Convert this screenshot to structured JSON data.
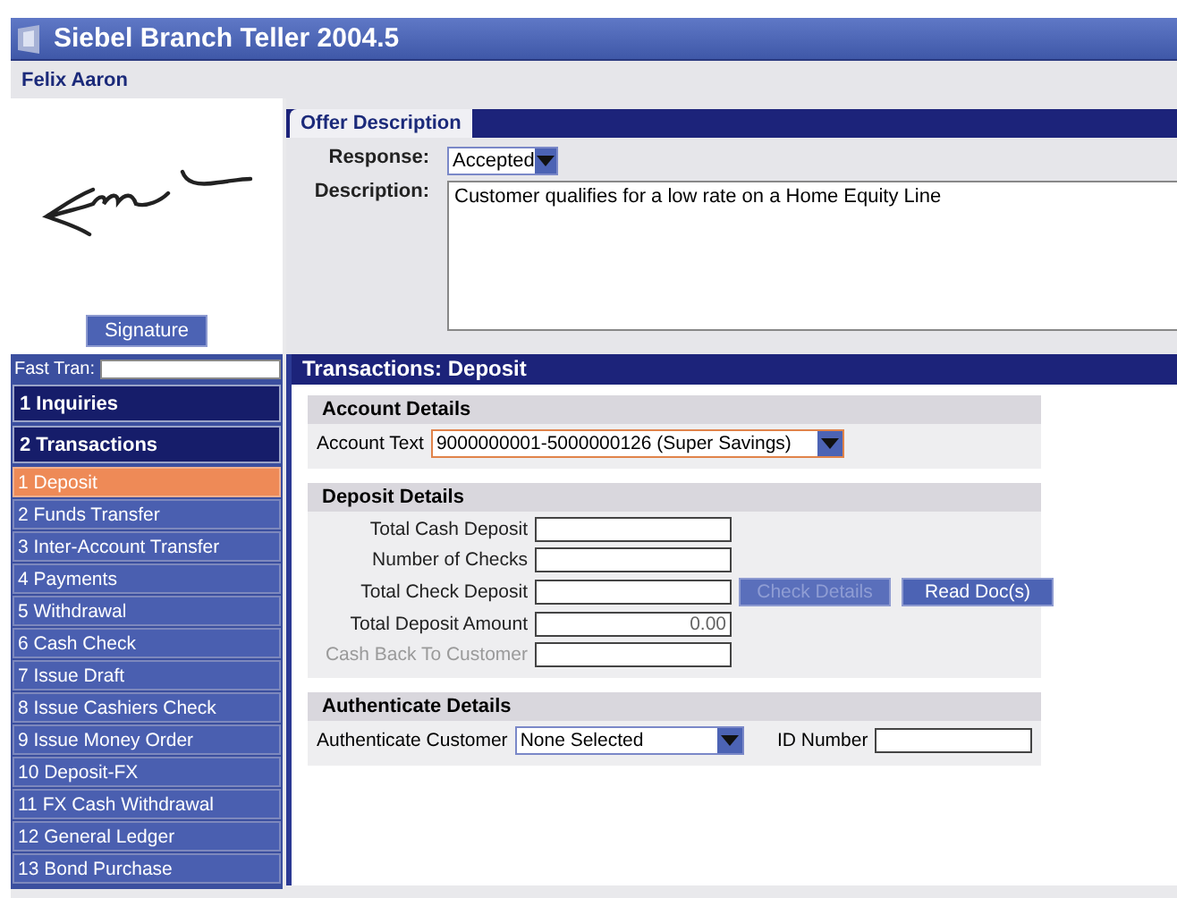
{
  "window": {
    "title": "Siebel Branch Teller 2004.5"
  },
  "customer_name": "Felix Aaron",
  "signature": {
    "button": "Signature"
  },
  "offer": {
    "tabs": [
      {
        "label": "Offer Description",
        "selected": true
      }
    ],
    "response": {
      "label": "Response:",
      "value": "Accepted"
    },
    "description": {
      "label": "Description:",
      "value": "Customer qualifies for a low rate on a Home Equity Line"
    }
  },
  "fast_tran": {
    "label": "Fast Tran:"
  },
  "nav": [
    {
      "label": "1 Inquiries",
      "kind": "group",
      "selected": false
    },
    {
      "label": "2 Transactions",
      "kind": "group",
      "selected": false
    },
    {
      "label": "1 Deposit",
      "kind": "item",
      "selected": true
    },
    {
      "label": "2 Funds Transfer",
      "kind": "item",
      "selected": false
    },
    {
      "label": "3 Inter-Account Transfer",
      "kind": "item",
      "selected": false
    },
    {
      "label": "4 Payments",
      "kind": "item",
      "selected": false
    },
    {
      "label": "5 Withdrawal",
      "kind": "item",
      "selected": false
    },
    {
      "label": "6 Cash Check",
      "kind": "item",
      "selected": false
    },
    {
      "label": "7 Issue Draft",
      "kind": "item",
      "selected": false
    },
    {
      "label": "8 Issue Cashiers Check",
      "kind": "item",
      "selected": false
    },
    {
      "label": "9 Issue Money Order",
      "kind": "item",
      "selected": false
    },
    {
      "label": "10 Deposit-FX",
      "kind": "item",
      "selected": false
    },
    {
      "label": "11 FX Cash Withdrawal",
      "kind": "item",
      "selected": false
    },
    {
      "label": "12 General Ledger",
      "kind": "item",
      "selected": false
    },
    {
      "label": "13 Bond Purchase",
      "kind": "item",
      "selected": false
    }
  ],
  "transaction": {
    "title": "Transactions: Deposit",
    "account_details": {
      "title": "Account Details",
      "label": "Account Text",
      "value": "9000000001-5000000126 (Super Savings)",
      "focused": true
    },
    "deposit_details": {
      "title": "Deposit Details",
      "fields": [
        {
          "label": "Total Cash Deposit",
          "kind": "input",
          "disabled": false
        },
        {
          "label": "Number of Checks",
          "kind": "input",
          "disabled": false
        },
        {
          "label": "Total Check Deposit",
          "kind": "input",
          "disabled": false,
          "buttons": [
            {
              "label": "Check Details",
              "disabled": true
            },
            {
              "label": "Read Doc(s)",
              "disabled": false
            }
          ]
        },
        {
          "label": "Total Deposit Amount",
          "kind": "readonly",
          "value": "0.00",
          "disabled": false
        },
        {
          "label": "Cash Back To Customer",
          "kind": "input",
          "disabled": true
        }
      ]
    },
    "authenticate_details": {
      "title": "Authenticate Details",
      "label": "Authenticate Customer",
      "value": "None Selected",
      "id_label": "ID Number"
    }
  }
}
